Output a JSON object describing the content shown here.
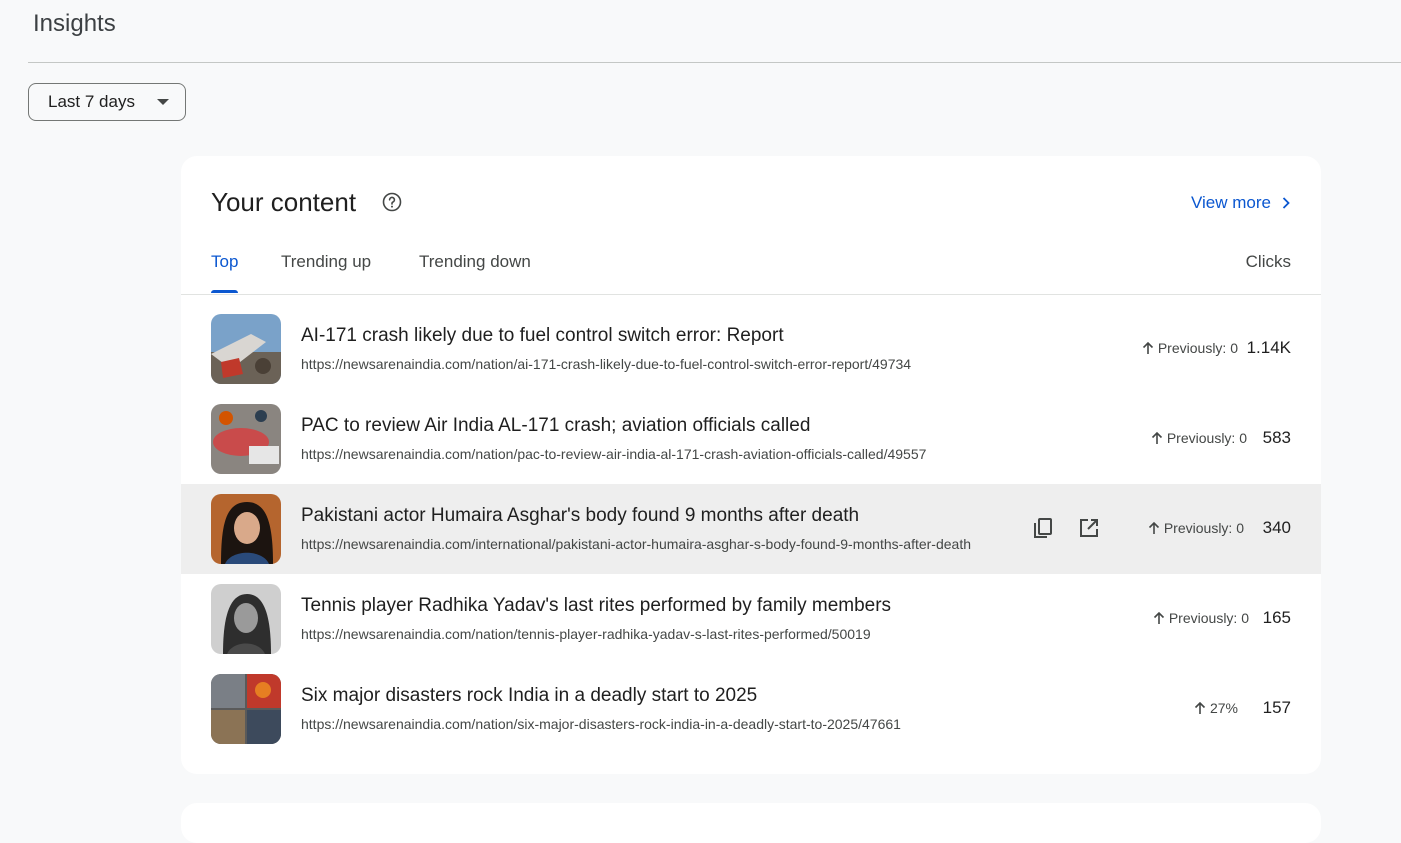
{
  "page": {
    "title": "Insights"
  },
  "filter": {
    "selected": "Last 7 days"
  },
  "card": {
    "title": "Your content",
    "view_more": "View more",
    "tabs": [
      {
        "label": "Top",
        "active": true
      },
      {
        "label": "Trending up",
        "active": false
      },
      {
        "label": "Trending down",
        "active": false
      }
    ],
    "column_header": "Clicks",
    "rows": [
      {
        "title": "AI-171 crash likely due to fuel control switch error: Report",
        "url": "https://newsarenaindia.com/nation/ai-171-crash-likely-due-to-fuel-control-switch-error-report/49734",
        "trend": "Previously: 0",
        "clicks": "1.14K",
        "thumb": "plane-wreck-image"
      },
      {
        "title": "PAC to review Air India AL-171 crash; aviation officials called",
        "url": "https://newsarenaindia.com/nation/pac-to-review-air-india-al-171-crash-aviation-officials-called/49557",
        "trend": "Previously: 0",
        "clicks": "583",
        "thumb": "crash-site-image"
      },
      {
        "title": "Pakistani actor Humaira Asghar's body found 9 months after death",
        "url": "https://newsarenaindia.com/international/pakistani-actor-humaira-asghar-s-body-found-9-months-after-death",
        "trend": "Previously: 0",
        "clicks": "340",
        "thumb": "portrait-image",
        "hover": true
      },
      {
        "title": "Tennis player Radhika Yadav's last rites performed by family members",
        "url": "https://newsarenaindia.com/nation/tennis-player-radhika-yadav-s-last-rites-performed/50019",
        "trend": "Previously: 0",
        "clicks": "165",
        "thumb": "bw-portrait-image"
      },
      {
        "title": "Six major disasters rock India in a deadly start to 2025",
        "url": "https://newsarenaindia.com/nation/six-major-disasters-rock-india-in-a-deadly-start-to-2025/47661",
        "trend": "27%",
        "clicks": "157",
        "thumb": "disaster-collage-image"
      }
    ]
  },
  "colors": {
    "accent": "#0b57d0",
    "hover_row": "#eeeeee"
  }
}
